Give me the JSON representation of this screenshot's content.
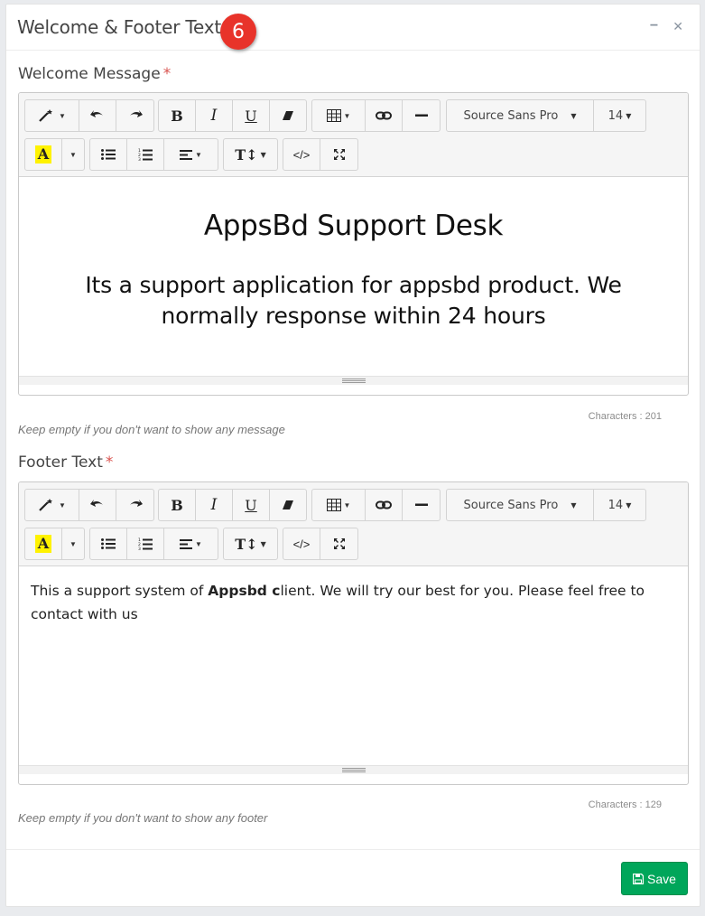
{
  "panel": {
    "title": "Welcome & Footer Text",
    "step_badge": "6",
    "minimize_glyph": "−",
    "close_glyph": "✕"
  },
  "welcome": {
    "label": "Welcome Message",
    "required_mark": "*",
    "heading": "AppsBd Support Desk",
    "paragraph": "Its a support application for appsbd product. We normally response within 24 hours",
    "counter": "Characters : 201",
    "help": "Keep empty if you don't want to show any message"
  },
  "footer": {
    "label": "Footer Text",
    "required_mark": "*",
    "text_before": "This a support system of ",
    "text_bold": "Appsbd c",
    "text_after": "lient. We will try our best for you. Please feel free to contact with us",
    "counter": "Characters : 129",
    "help": "Keep empty if you don't want to show any footer"
  },
  "toolbar": {
    "bold": "B",
    "italic": "I",
    "underline": "U",
    "font_name": "Source Sans Pro",
    "font_size": "14",
    "text_color": "A",
    "textsize": "T↕",
    "code_view": "</>",
    "caret": "▼"
  },
  "actions": {
    "save_label": "Save"
  },
  "colors": {
    "accent": "#00a65a",
    "badge": "#e8332a",
    "highlight": "#fff200"
  }
}
